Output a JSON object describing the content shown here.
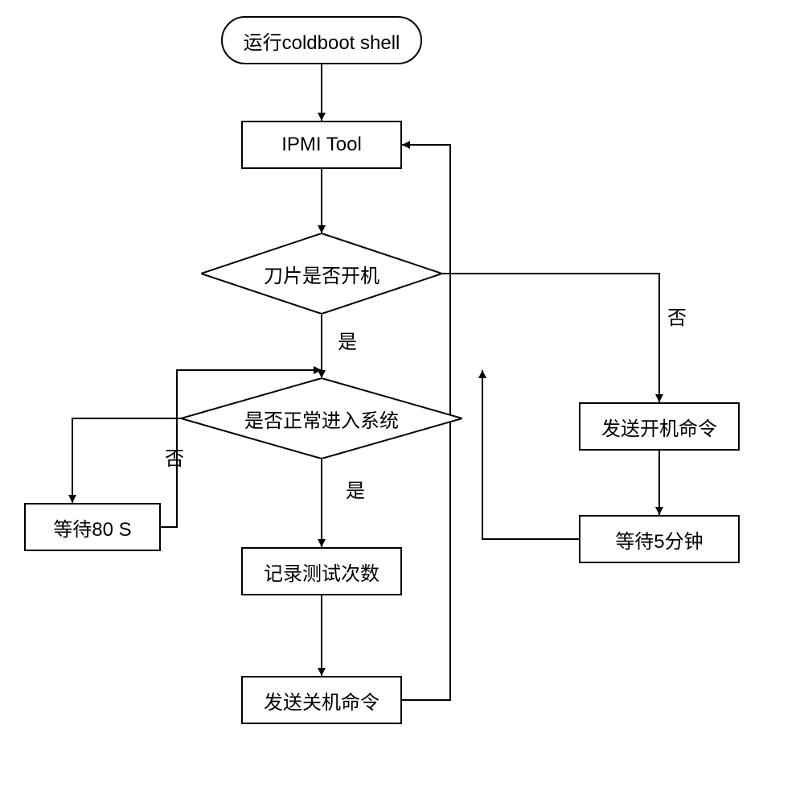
{
  "nodes": {
    "start": "运行coldboot shell",
    "ipmi": "IPMI Tool",
    "d1": "刀片是否开机",
    "d2": "是否正常进入系统",
    "wait80": "等待80 S",
    "record": "记录测试次数",
    "shutdown": "发送关机命令",
    "poweron": "发送开机命令",
    "wait5": "等待5分钟"
  },
  "labels": {
    "yes": "是",
    "no": "否"
  }
}
